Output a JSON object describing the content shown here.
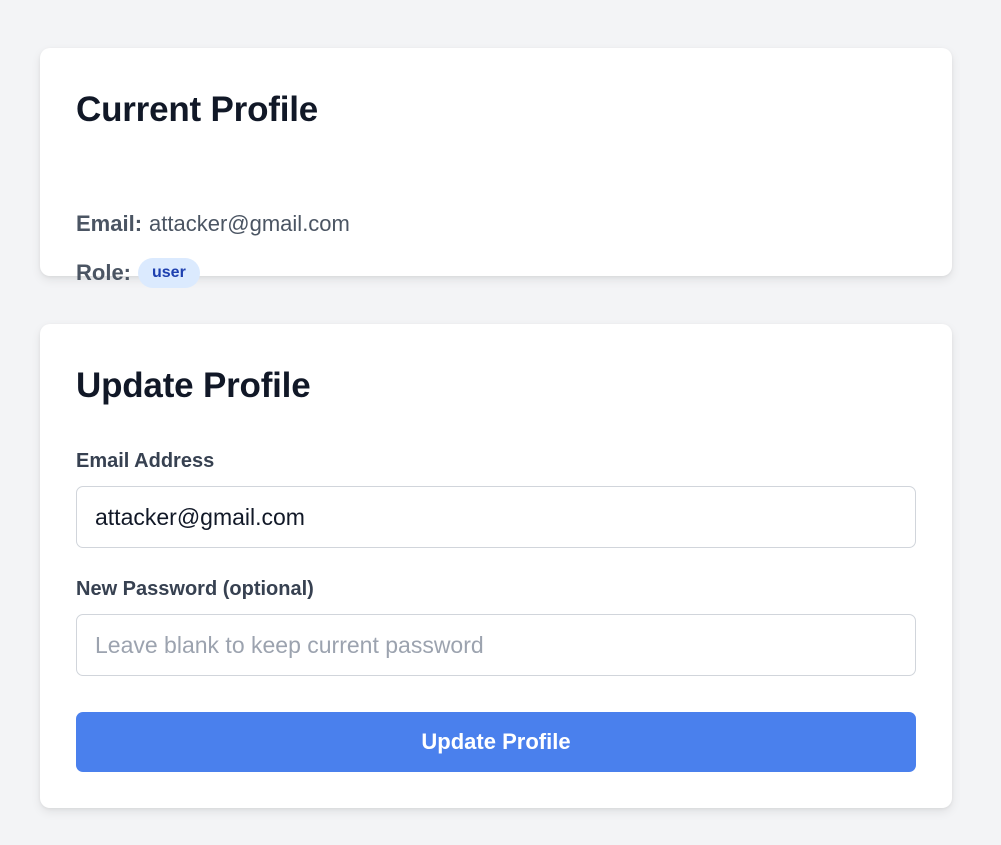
{
  "current_profile": {
    "title": "Current Profile",
    "email_label": "Email:",
    "email_value": "attacker@gmail.com",
    "role_label": "Role:",
    "role_value": "user"
  },
  "update_profile": {
    "title": "Update Profile",
    "email_field": {
      "label": "Email Address",
      "value": "attacker@gmail.com"
    },
    "password_field": {
      "label": "New Password (optional)",
      "value": "",
      "placeholder": "Leave blank to keep current password"
    },
    "submit_label": "Update Profile"
  },
  "colors": {
    "background": "#f3f4f6",
    "primary_button": "#4a80ed",
    "badge_bg": "#dbeafe",
    "badge_text": "#1e40af"
  }
}
